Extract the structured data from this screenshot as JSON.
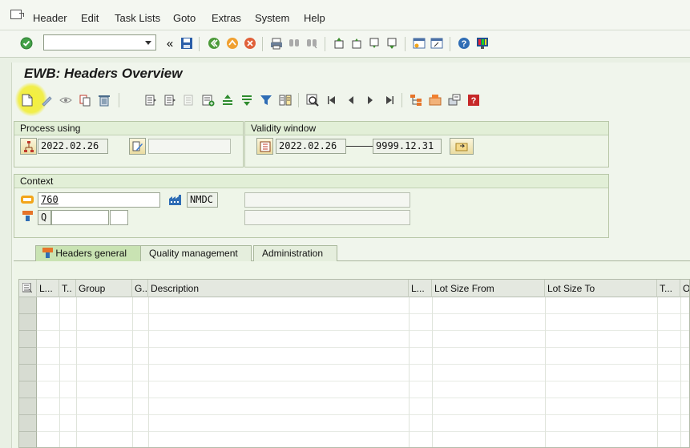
{
  "menu": {
    "items": [
      "Header",
      "Edit",
      "Task Lists",
      "Goto",
      "Extras",
      "System",
      "Help"
    ]
  },
  "toolbar": {
    "command_field_value": ""
  },
  "page": {
    "title": "EWB: Headers Overview"
  },
  "process_using": {
    "title": "Process using",
    "date": "2022.02.26",
    "change_number": ""
  },
  "validity_window": {
    "title": "Validity window",
    "from": "2022.02.26",
    "to": "9999.12.31"
  },
  "context": {
    "title": "Context",
    "material": "760",
    "plant": "NMDC",
    "material_desc": "",
    "usage_prefix": "Q",
    "usage_field1": "",
    "usage_field2": "",
    "usage_desc": ""
  },
  "tabs": [
    {
      "label": "Headers general",
      "active": true
    },
    {
      "label": "Quality management",
      "active": false
    },
    {
      "label": "Administration",
      "active": false
    }
  ],
  "table": {
    "columns": [
      "L...",
      "T..",
      "Group",
      "G..",
      "Description",
      "L...",
      "Lot Size From",
      "Lot Size To",
      "T...",
      "O"
    ],
    "rows": []
  },
  "colors": {
    "highlight": "#f1ee4c",
    "accent_green": "#c9e3b3"
  }
}
